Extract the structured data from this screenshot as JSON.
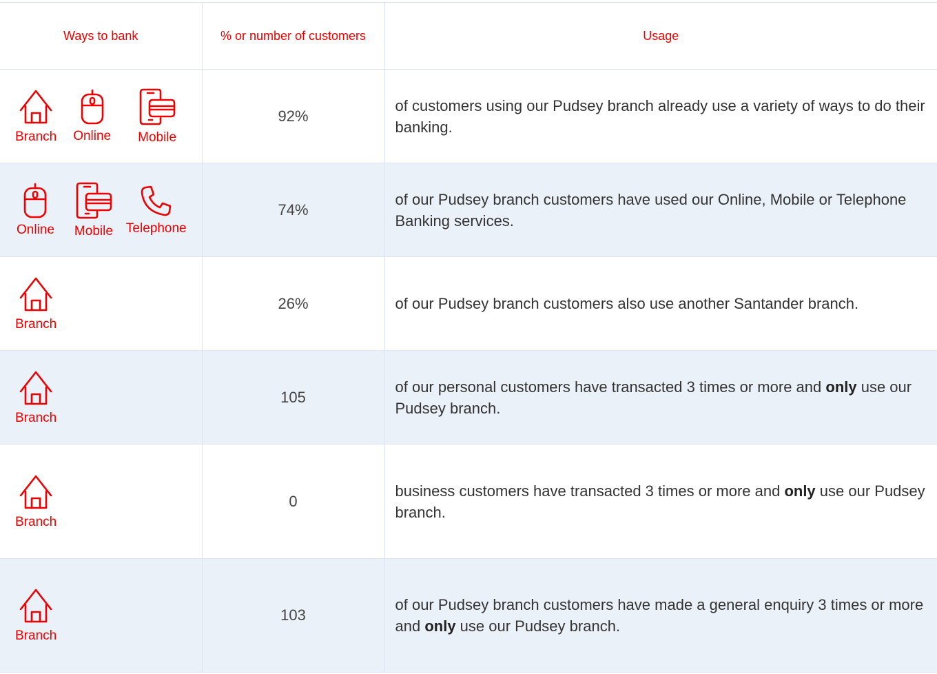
{
  "headers": {
    "ways": "Ways to bank",
    "number": "% or number of customers",
    "usage": "Usage"
  },
  "rows": [
    {
      "channels": [
        {
          "label": "Branch",
          "icon": "house-icon"
        },
        {
          "label": "Online",
          "icon": "mouse-icon"
        },
        {
          "label": "Mobile",
          "icon": "mobile-card-icon"
        }
      ],
      "value": "92%",
      "usage_pre": "of customers using our Pudsey branch already use a variety of ways to do their banking.",
      "usage_bold": "",
      "usage_post": ""
    },
    {
      "channels": [
        {
          "label": "Online",
          "icon": "mouse-icon"
        },
        {
          "label": "Mobile",
          "icon": "mobile-card-icon"
        },
        {
          "label": "Telephone",
          "icon": "phone-icon"
        }
      ],
      "value": "74%",
      "usage_pre": "of our Pudsey branch customers have used our Online, Mobile or Telephone Banking services.",
      "usage_bold": "",
      "usage_post": ""
    },
    {
      "channels": [
        {
          "label": "Branch",
          "icon": "house-icon"
        }
      ],
      "value": "26%",
      "usage_pre": "of our Pudsey branch customers also use another Santander branch.",
      "usage_bold": "",
      "usage_post": ""
    },
    {
      "channels": [
        {
          "label": "Branch",
          "icon": "house-icon"
        }
      ],
      "value": "105",
      "usage_pre": "of our personal customers have transacted 3 times or more and ",
      "usage_bold": "only",
      "usage_post": " use our Pudsey branch."
    },
    {
      "channels": [
        {
          "label": "Branch",
          "icon": "house-icon"
        }
      ],
      "value": "0",
      "usage_pre": "business customers have transacted 3 times or more and ",
      "usage_bold": "only",
      "usage_post": " use our Pudsey branch."
    },
    {
      "channels": [
        {
          "label": "Branch",
          "icon": "house-icon"
        }
      ],
      "value": "103",
      "usage_pre": "of our Pudsey branch customers have made a general enquiry 3 times or more and ",
      "usage_bold": "only",
      "usage_post": " use our Pudsey branch."
    }
  ],
  "colors": {
    "accent": "#ec0000",
    "row_alt": "#ebf1f8",
    "border": "#dce4ef"
  }
}
